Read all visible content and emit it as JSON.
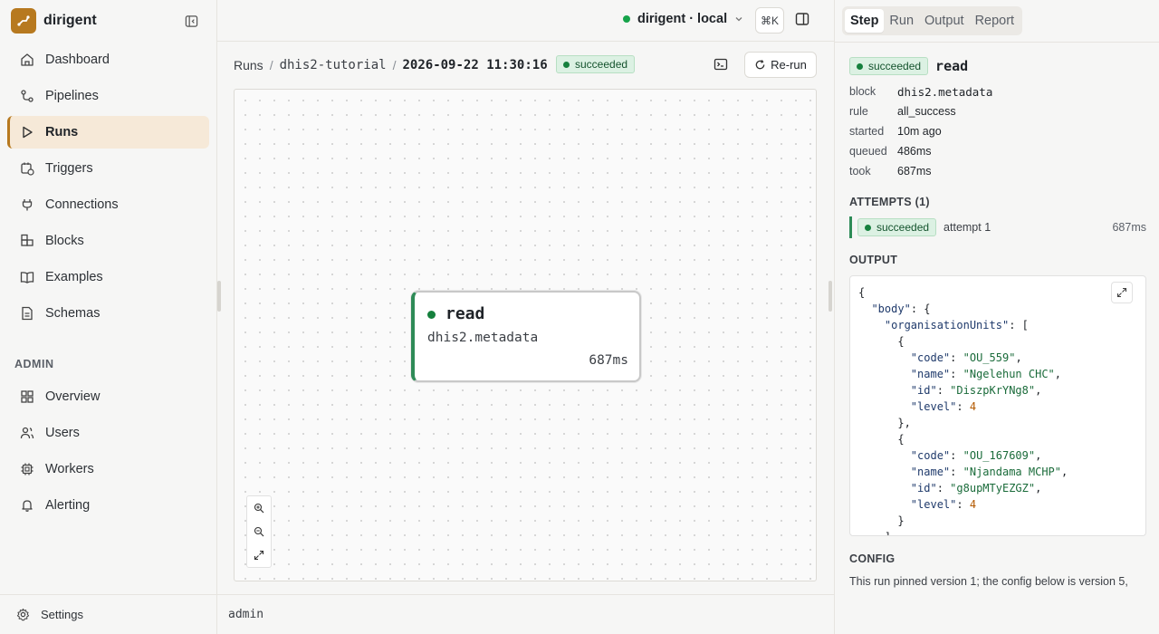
{
  "app": {
    "name": "dirigent"
  },
  "sidebar": {
    "items": [
      {
        "label": "Dashboard",
        "icon": "home-icon"
      },
      {
        "label": "Pipelines",
        "icon": "pipelines-icon"
      },
      {
        "label": "Runs",
        "icon": "play-icon"
      },
      {
        "label": "Triggers",
        "icon": "calendar-clock-icon"
      },
      {
        "label": "Connections",
        "icon": "plug-icon"
      },
      {
        "label": "Blocks",
        "icon": "blocks-icon"
      },
      {
        "label": "Examples",
        "icon": "book-icon"
      },
      {
        "label": "Schemas",
        "icon": "file-icon"
      }
    ],
    "admin_label": "ADMIN",
    "admin_items": [
      {
        "label": "Overview",
        "icon": "grid-icon"
      },
      {
        "label": "Users",
        "icon": "users-icon"
      },
      {
        "label": "Workers",
        "icon": "cpu-icon"
      },
      {
        "label": "Alerting",
        "icon": "bell-icon"
      }
    ],
    "settings_label": "Settings"
  },
  "topbar": {
    "environment": "dirigent · local",
    "shortcut": "⌘K"
  },
  "breadcrumb": {
    "items": [
      "Runs",
      "dhis2-tutorial",
      "2026-09-22 11:30:16"
    ],
    "status": "succeeded",
    "rerun_label": "Re-run"
  },
  "graph": {
    "node": {
      "title": "read",
      "block": "dhis2.metadata",
      "duration": "687ms",
      "status": "succeeded"
    }
  },
  "footer": {
    "user": "admin"
  },
  "panel": {
    "tabs": [
      "Step",
      "Run",
      "Output",
      "Report"
    ],
    "active_tab": "Step",
    "step": {
      "status": "succeeded",
      "name": "read",
      "fields": [
        {
          "key": "block",
          "value": "dhis2.metadata"
        },
        {
          "key": "rule",
          "value": "all_success"
        },
        {
          "key": "started",
          "value": "10m ago"
        },
        {
          "key": "queued",
          "value": "486ms"
        },
        {
          "key": "took",
          "value": "687ms"
        }
      ]
    },
    "attempts_label": "ATTEMPTS (1)",
    "attempts": [
      {
        "status": "succeeded",
        "label": "attempt 1",
        "duration": "687ms"
      }
    ],
    "output_label": "OUTPUT",
    "output": {
      "units": [
        {
          "code": "OU_559",
          "name": "Ngelehun CHC",
          "id": "DiszpKrYNg8",
          "level": 4
        },
        {
          "code": "OU_167609",
          "name": "Njandama MCHP",
          "id": "g8upMTyEZGZ",
          "level": 4
        }
      ]
    },
    "config_label": "CONFIG",
    "config_note": "This run pinned version 1; the config below is version 5,"
  },
  "colors": {
    "accent": "#b7791f",
    "success": "#15803d",
    "success_bg": "#dcf1e3"
  }
}
